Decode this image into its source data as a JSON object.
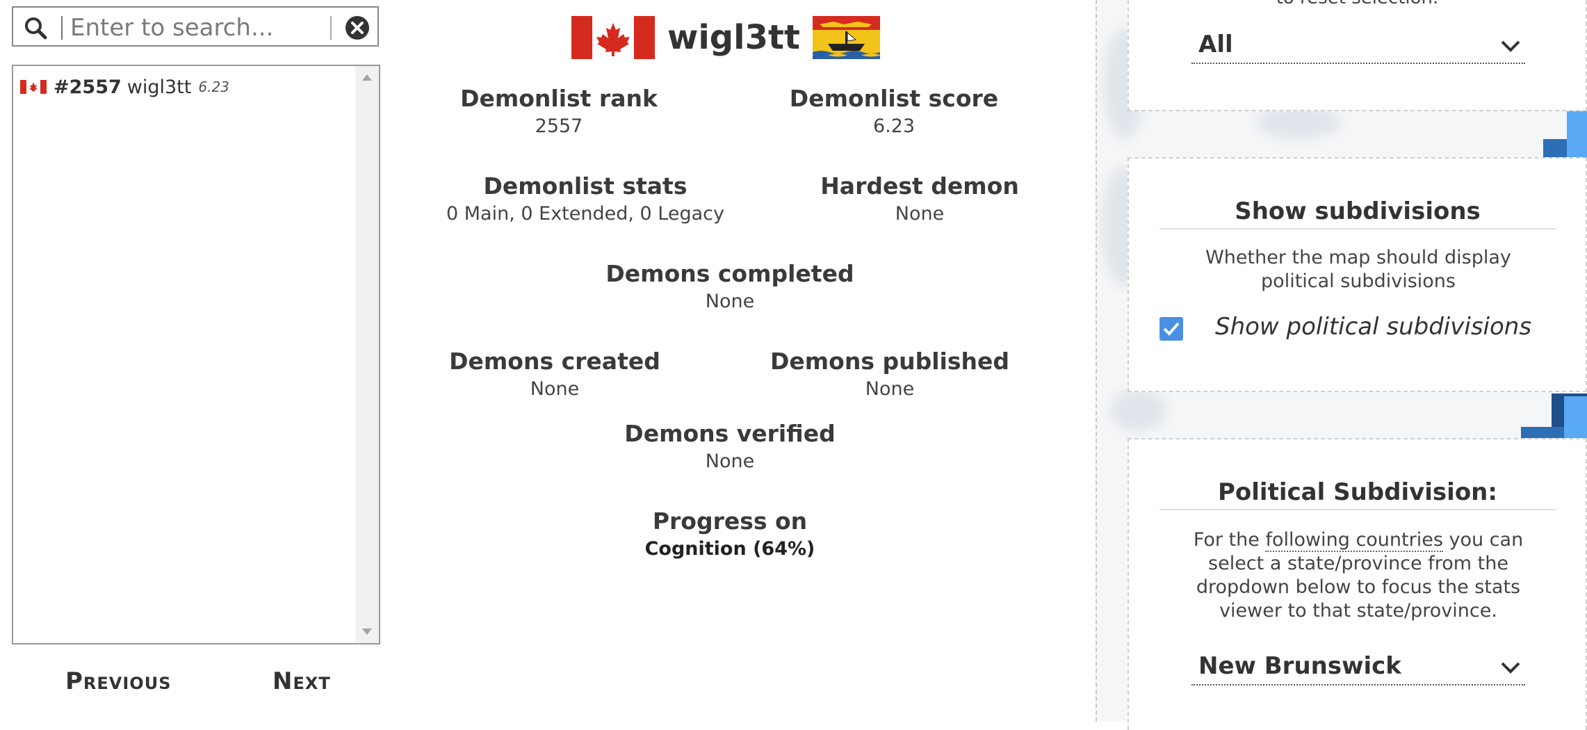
{
  "search": {
    "placeholder": "Enter to search..."
  },
  "results": [
    {
      "country": "Canada",
      "rank": "#2557",
      "name": "wigl3tt",
      "score": "6.23"
    }
  ],
  "pagination": {
    "previous_label": "Previous",
    "next_label": "Next"
  },
  "player": {
    "name": "wigl3tt",
    "nationality_flag": "Canada",
    "subdivision_flag": "New Brunswick",
    "stats": {
      "rank_label": "Demonlist rank",
      "rank_value": "2557",
      "score_label": "Demonlist score",
      "score_value": "6.23",
      "stats_label": "Demonlist stats",
      "stats_value": "0 Main, 0 Extended, 0 Legacy",
      "hardest_label": "Hardest demon",
      "hardest_value": "None",
      "completed_label": "Demons completed",
      "completed_value": "None",
      "created_label": "Demons created",
      "created_value": "None",
      "published_label": "Demons published",
      "published_value": "None",
      "verified_label": "Demons verified",
      "verified_value": "None",
      "progress_label": "Progress on",
      "progress_value": "Cognition (64%)"
    }
  },
  "filters": {
    "reset_hint": "to reset selection.",
    "region_selected": "All",
    "subdivisions": {
      "title": "Show subdivisions",
      "description": "Whether the map should display political subdivisions",
      "checkbox_label": "Show political subdivisions",
      "checked": true
    },
    "political": {
      "title": "Political Subdivision:",
      "desc_before": "For the ",
      "desc_link": "following countries",
      "desc_after": " you can select a state/province from the dropdown below to focus the stats viewer to that state/province.",
      "selected": "New Brunswick"
    }
  },
  "colors": {
    "accent_blue": "#4a90e2",
    "canada_red": "#d52b1e",
    "deco_blue_light": "#5aa9f5",
    "deco_blue_dark": "#2d6fb5"
  },
  "icons": [
    "search-icon",
    "clear-icon",
    "chevron-down-icon",
    "check-icon"
  ]
}
